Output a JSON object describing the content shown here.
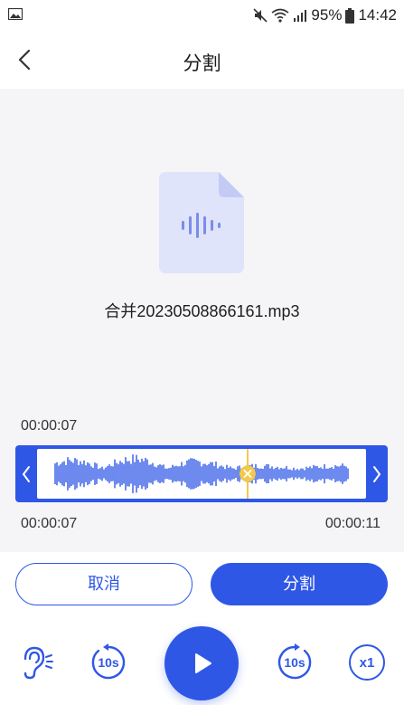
{
  "status_bar": {
    "battery_percent": "95%",
    "time": "14:42",
    "icons": [
      "image-icon",
      "mute-icon",
      "wifi-icon",
      "signal-icon",
      "battery-icon"
    ]
  },
  "header": {
    "title": "分割",
    "back_icon": "back-arrow-icon"
  },
  "file": {
    "icon": "audio-file-icon",
    "name": "合并20230508866161.mp3"
  },
  "trim": {
    "current_time": "00:00:07",
    "start_time": "00:00:07",
    "end_time": "00:00:11",
    "playhead_fraction": 0.64
  },
  "actions": {
    "cancel_label": "取消",
    "split_label": "分割"
  },
  "player": {
    "rewind_label": "10s",
    "forward_label": "10s",
    "speed_label": "x1"
  },
  "colors": {
    "accent": "#2f57e6",
    "playhead": "#f2c94c",
    "background": "#f5f5f7"
  }
}
